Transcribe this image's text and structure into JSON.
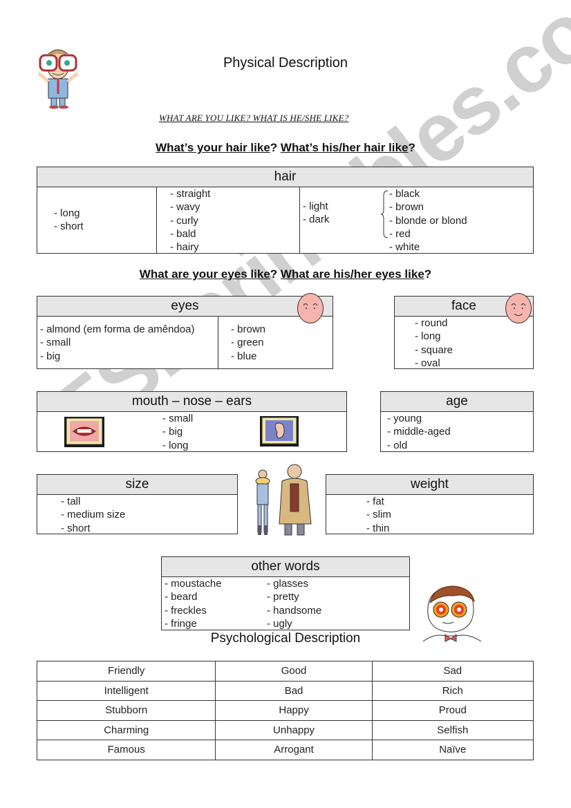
{
  "header": {
    "title": "Physical  Description",
    "subtitle": "WHAT ARE YOU LIKE? WHAT IS HE/SHE LIKE?"
  },
  "hair_question": {
    "part1": "What’s your hair like",
    "sep": "?",
    "part2": "What’s his/her hair like",
    "end": "?"
  },
  "hair": {
    "heading": "hair",
    "length": [
      "- long",
      "- short"
    ],
    "type": [
      "- straight",
      "- wavy",
      "- curly",
      "- bald",
      "- hairy"
    ],
    "tone": [
      "- light",
      "- dark"
    ],
    "colors": [
      "- black",
      "- brown",
      "- blonde or blond",
      "- red",
      "- white"
    ]
  },
  "eyes_question": {
    "part1": "What are your eyes like",
    "sep": "?",
    "part2": "What are his/her eyes like",
    "end": "?"
  },
  "eyes": {
    "heading": "eyes",
    "shape": [
      "- almond (em forma de amêndoa)",
      "- small",
      "- big"
    ],
    "color": [
      "- brown",
      "- green",
      "- blue"
    ]
  },
  "face": {
    "heading": "face",
    "items": [
      "- round",
      "- long",
      "- square",
      "- oval"
    ]
  },
  "mouth_nose_ears": {
    "heading": "mouth  – nose  – ears",
    "items": [
      "- small",
      "- big",
      "- long"
    ]
  },
  "age": {
    "heading": "age",
    "items": [
      "- young",
      "- middle-aged",
      "- old"
    ]
  },
  "size": {
    "heading": "size",
    "items": [
      "- tall",
      "- medium size",
      "- short"
    ]
  },
  "weight": {
    "heading": "weight",
    "items": [
      "- fat",
      "- slim",
      "- thin"
    ]
  },
  "other_words": {
    "heading": "other words",
    "col1": [
      "- moustache",
      "- beard",
      "- freckles",
      "- fringe"
    ],
    "col2": [
      "- glasses",
      "- pretty",
      "- handsome",
      "- ugly"
    ]
  },
  "psychological": {
    "title": "Psychological  Description",
    "rows": [
      [
        "Friendly",
        "Good",
        "Sad"
      ],
      [
        "Intelligent",
        "Bad",
        "Rich"
      ],
      [
        "Stubborn",
        "Happy",
        "Proud"
      ],
      [
        "Charming",
        "Unhappy",
        "Selfish"
      ],
      [
        "Famous",
        "Arrogant",
        "Naïve"
      ]
    ]
  },
  "watermark": "ESLprintables.com",
  "icons": {
    "teacher": "cartoon-man-with-glasses-icon",
    "face_smile": "smiley-face-icon",
    "mouth": "mouth-picture-icon",
    "ear": "ear-picture-icon",
    "people": "tall-and-fat-men-icon",
    "boy": "boy-with-glasses-icon"
  }
}
